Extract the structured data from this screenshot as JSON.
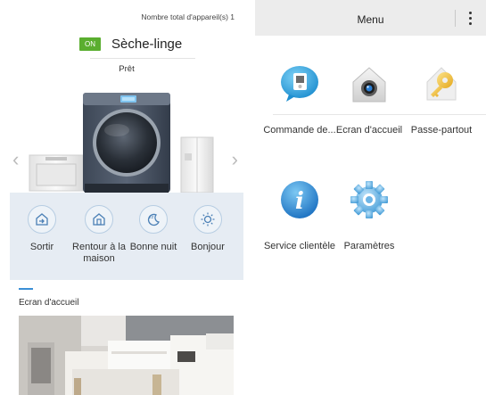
{
  "left": {
    "device_count": "Nombre total d'appareil(s) 1",
    "device": {
      "power_badge": "ON",
      "name": "Sèche-linge",
      "status": "Prêt"
    },
    "carousel": {
      "prev_icon": "chevron-left-icon",
      "next_icon": "chevron-right-icon"
    },
    "modes": [
      {
        "label": "Sortir",
        "icon": "exit-house-icon"
      },
      {
        "label": "Rentour à la maison",
        "icon": "home-icon"
      },
      {
        "label": "Bonne nuit",
        "icon": "moon-sleep-icon"
      },
      {
        "label": "Bonjour",
        "icon": "sun-icon"
      }
    ],
    "home_screen_title": "Ecran d'accueil"
  },
  "right": {
    "menu_title": "Menu",
    "tiles": [
      {
        "label": "Commande de...",
        "icon": "remote-control-chat-icon"
      },
      {
        "label": "Ecran d'accueil",
        "icon": "home-camera-icon"
      },
      {
        "label": "Passe-partout",
        "icon": "key-icon"
      },
      {
        "label": "Service clientèle",
        "icon": "info-icon"
      },
      {
        "label": "Paramètres",
        "icon": "gear-icon"
      }
    ]
  },
  "colors": {
    "on_badge": "#5aae2f",
    "accent": "#3b8fd6",
    "mode_bar": "#e6ecf3",
    "menu_bar": "#ececec"
  }
}
